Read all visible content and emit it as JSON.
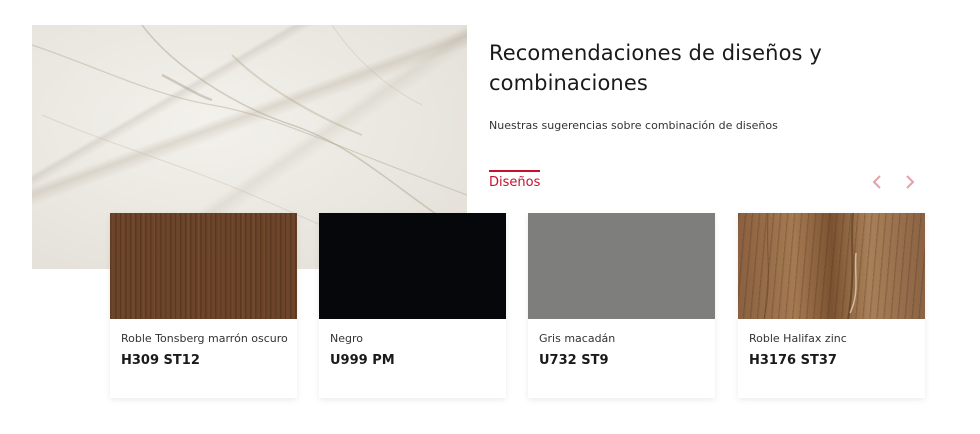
{
  "header": {
    "title": "Recomendaciones de diseños y combinaciones",
    "subtitle": "Nuestras sugerencias sobre combinación de diseños"
  },
  "tabs": [
    {
      "label": "Diseños",
      "active": true
    }
  ],
  "carousel": {
    "prev_icon": "chevron-left-icon",
    "next_icon": "chevron-right-icon",
    "accent_color": "#c8102e"
  },
  "cards": [
    {
      "name": "Roble Tonsberg marrón oscuro",
      "code": "H309 ST12"
    },
    {
      "name": "Negro",
      "code": "U999 PM"
    },
    {
      "name": "Gris macadán",
      "code": "U732 ST9"
    },
    {
      "name": "Roble Halifax zinc",
      "code": "H3176 ST37"
    }
  ]
}
